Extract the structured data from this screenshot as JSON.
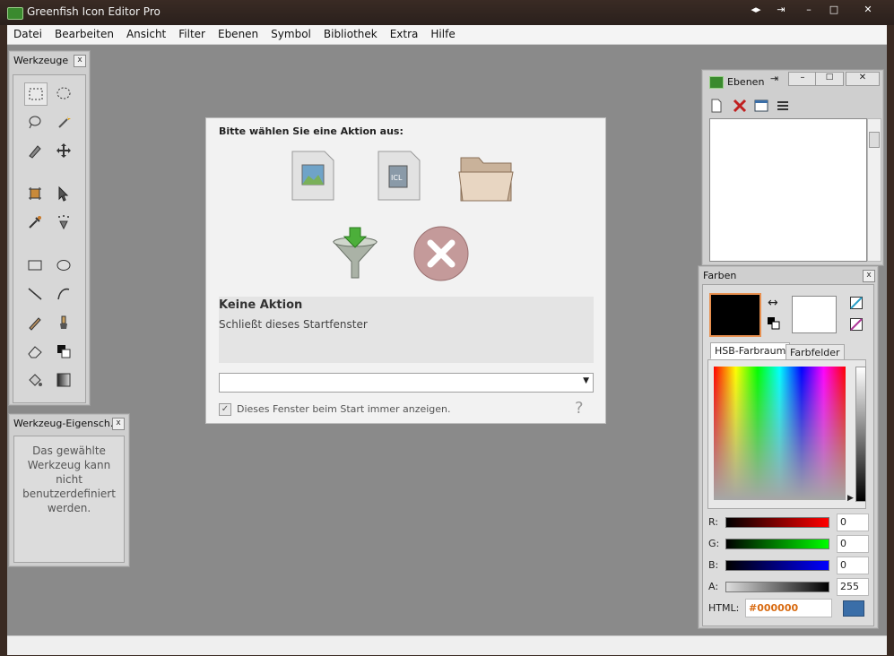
{
  "window": {
    "title": "Greenfish Icon Editor Pro"
  },
  "menu": [
    "Datei",
    "Bearbeiten",
    "Ansicht",
    "Filter",
    "Ebenen",
    "Symbol",
    "Bibliothek",
    "Extra",
    "Hilfe"
  ],
  "tools_panel": {
    "title": "Werkzeuge",
    "close": "x"
  },
  "props_panel": {
    "title": "Werkzeug-Eigensch...",
    "close": "x",
    "message": "Das gewählte Werkzeug kann nicht benutzerdefiniert werden."
  },
  "startup": {
    "heading": "Bitte wählen Sie eine Aktion aus:",
    "action_title": "Keine Aktion",
    "action_desc": "Schließt dieses Startfenster",
    "checkbox_label": "Dieses Fenster beim Start immer anzeigen.",
    "checkbox_checked": true,
    "icl_label": "ICL",
    "help": "?"
  },
  "layers": {
    "title": "Ebenen"
  },
  "colors": {
    "title": "Farben",
    "close": "x",
    "tab_hsb": "HSB-Farbraum",
    "tab_swatches": "Farbfelder",
    "r_label": "R:",
    "r": "0",
    "g_label": "G:",
    "g": "0",
    "b_label": "B:",
    "b": "0",
    "a_label": "A:",
    "a": "255",
    "html_label": "HTML:",
    "html": "#000000",
    "primary": "#000000",
    "secondary": "#ffffff"
  }
}
